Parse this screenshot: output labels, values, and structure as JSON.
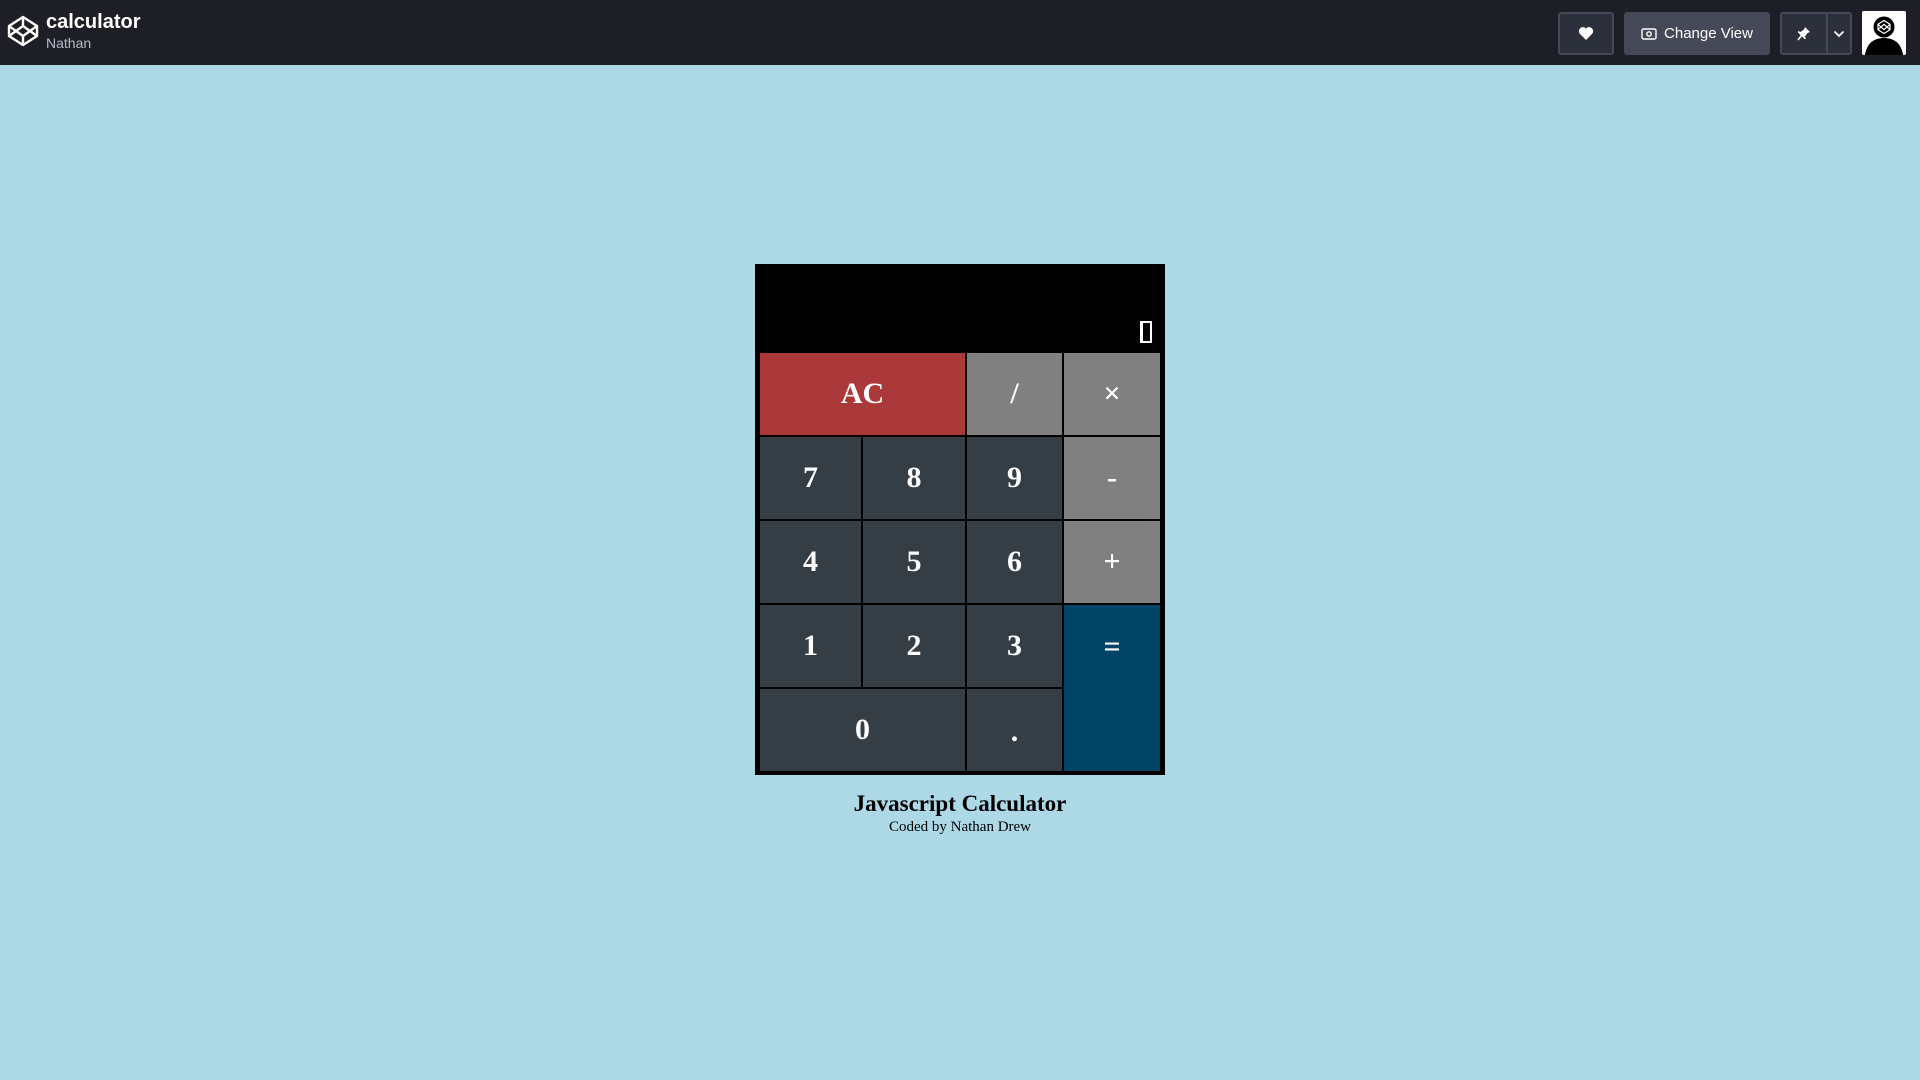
{
  "header": {
    "title": "calculator",
    "author": "Nathan",
    "logo_icon": "codepen-logo-icon",
    "heart_icon": "heart-icon",
    "change_view_label": "Change View",
    "change_view_icon": "eye-icon",
    "pin_icon": "pin-icon",
    "dropdown_icon": "chevron-down-icon",
    "avatar_icon": "avatar-icon"
  },
  "calculator": {
    "display_value": "",
    "keys": {
      "clear": "AC",
      "divide": "/",
      "multiply": "×",
      "seven": "7",
      "eight": "8",
      "nine": "9",
      "subtract": "-",
      "four": "4",
      "five": "5",
      "six": "6",
      "add": "+",
      "one": "1",
      "two": "2",
      "three": "3",
      "equals": "=",
      "zero": "0",
      "decimal": "."
    }
  },
  "footer": {
    "title": "Javascript Calculator",
    "subtitle": "Coded by Nathan Drew"
  },
  "colors": {
    "page_background": "#add8e6",
    "topbar_background": "#1e1f26",
    "number_key": "#343e44",
    "operator_key": "#808080",
    "clear_key": "#ac3939",
    "equals_key": "#004466"
  }
}
